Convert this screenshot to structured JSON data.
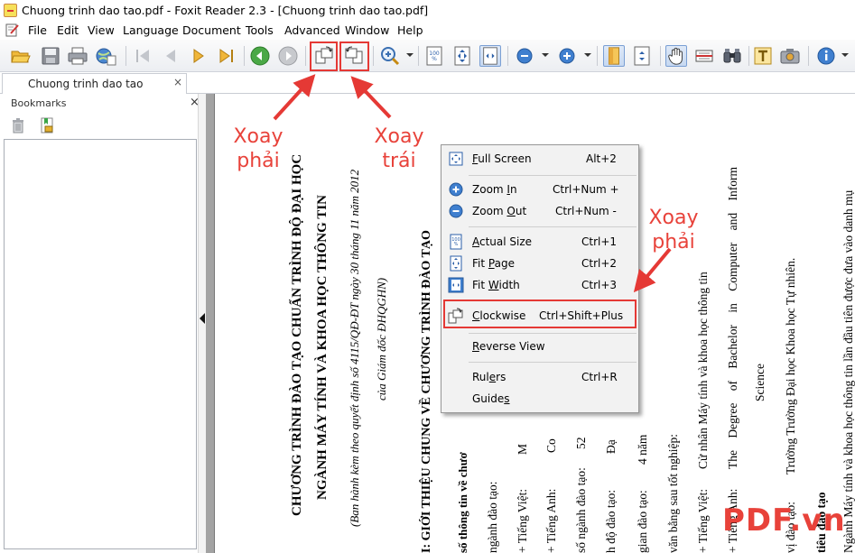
{
  "window": {
    "title": "Chuong trinh dao tao.pdf - Foxit Reader 2.3 - [Chuong trinh dao tao.pdf]"
  },
  "menubar": {
    "items": [
      "File",
      "Edit",
      "View",
      "Language",
      "Document",
      "Tools",
      "Advanced",
      "Window",
      "Help"
    ]
  },
  "toolbar": {
    "icons": [
      "open-icon",
      "save-icon",
      "print-icon",
      "web-icon",
      "first-page-icon",
      "prev-page-icon",
      "next-page-icon",
      "last-page-icon",
      "back-icon",
      "forward-icon",
      "rotate-right-icon",
      "rotate-left-icon",
      "zoom-icon",
      "actual-size-icon",
      "fit-page-icon",
      "fit-width-icon",
      "zoom-out-icon",
      "zoom-in-icon",
      "single-page-icon",
      "continuous-icon",
      "hand-icon",
      "select-icon",
      "find-icon",
      "typewriter-icon",
      "snapshot-icon",
      "info-icon"
    ]
  },
  "tab": {
    "label": "Chuong trinh dao tao",
    "close": "×"
  },
  "bookmarks": {
    "title": "Bookmarks",
    "close": "×"
  },
  "document": {
    "columns": [
      {
        "text": "CHƯƠNG TRÌNH ĐÀO TẠO CHUẨN TRÌNH ĐỘ ĐẠI HỌC"
      },
      {
        "text": "NGÀNH MÁY TÍNH VÀ KHOA HỌC THÔNG TIN"
      },
      {
        "text": "(Ban hành kèm theo quyết định số 4115/QĐ-ĐT ngày 30 tháng 11 năm 2012"
      },
      {
        "text": "của Giám đốc ĐHQGHN)"
      },
      {
        "text": "I: GIỚI THIỆU CHUNG VỀ CHƯƠNG TRÌNH ĐÀO TẠO"
      },
      {
        "text": "số thông tin về chươ"
      },
      {
        "a": "ngành đào tạo:",
        "b": ""
      },
      {
        "a": "+ Tiếng Việt:",
        "b": "M"
      },
      {
        "a": "+ Tiếng Anh:",
        "b": "Co"
      },
      {
        "a": "số ngành đào tạo:",
        "b": "52"
      },
      {
        "a": "h độ đào tạo:",
        "b": "Đạ"
      },
      {
        "a": "gian đào tạo:",
        "b": "4 năm"
      },
      {
        "a": "văn bằng sau tốt nghiệp:",
        "b": ""
      },
      {
        "a": "+ Tiếng Việt:",
        "b": "Cử nhân Máy tính và khoa học thông tin"
      },
      {
        "a": "+ Tiếng Anh:",
        "b": "The Degree of Bachelor in Computer and Inform"
      },
      {
        "a": "",
        "b": "Science"
      },
      {
        "a": "vị đào tạo:",
        "b": "Trường Trường Đại học Khoa học Tự nhiên."
      },
      {
        "a": "tiêu đào tạo",
        "b": ""
      },
      {
        "a": "",
        "b": "Ngành Máy tính và khoa học thông tin lần đầu tiên được đưa vào danh mụ"
      }
    ]
  },
  "context_menu": {
    "items": [
      {
        "label": "Full Screen",
        "ul": "F",
        "shortcut": "Alt+2",
        "icon": "full-screen-icon"
      },
      {
        "label": "Zoom In",
        "ul": "I",
        "shortcut": "Ctrl+Num +",
        "icon": "zoom-in-icon"
      },
      {
        "label": "Zoom Out",
        "ul": "O",
        "shortcut": "Ctrl+Num -",
        "icon": "zoom-out-icon"
      },
      {
        "label": "Actual Size",
        "ul": "A",
        "shortcut": "Ctrl+1",
        "icon": "actual-size-icon"
      },
      {
        "label": "Fit Page",
        "ul": "P",
        "shortcut": "Ctrl+2",
        "icon": "fit-page-icon"
      },
      {
        "label": "Fit Width",
        "ul": "W",
        "shortcut": "Ctrl+3",
        "icon": "fit-width-icon"
      },
      {
        "label": "Clockwise",
        "ul": "C",
        "shortcut": "Ctrl+Shift+Plus",
        "icon": "rotate-clockwise-icon"
      },
      {
        "label": "Reverse View",
        "ul": "R",
        "shortcut": "",
        "icon": ""
      },
      {
        "label": "Rulers",
        "ul": "e",
        "shortcut": "Ctrl+R",
        "icon": ""
      },
      {
        "label": "Guides",
        "ul": "s",
        "shortcut": "",
        "icon": ""
      }
    ]
  },
  "annotations": {
    "rotate_right_toolbar": [
      "Xoay",
      "phải"
    ],
    "rotate_left_toolbar": [
      "Xoay",
      "trái"
    ],
    "rotate_right_menu": [
      "Xoay",
      "phải"
    ],
    "color": "#e53935"
  },
  "watermark": "PDF.vn"
}
